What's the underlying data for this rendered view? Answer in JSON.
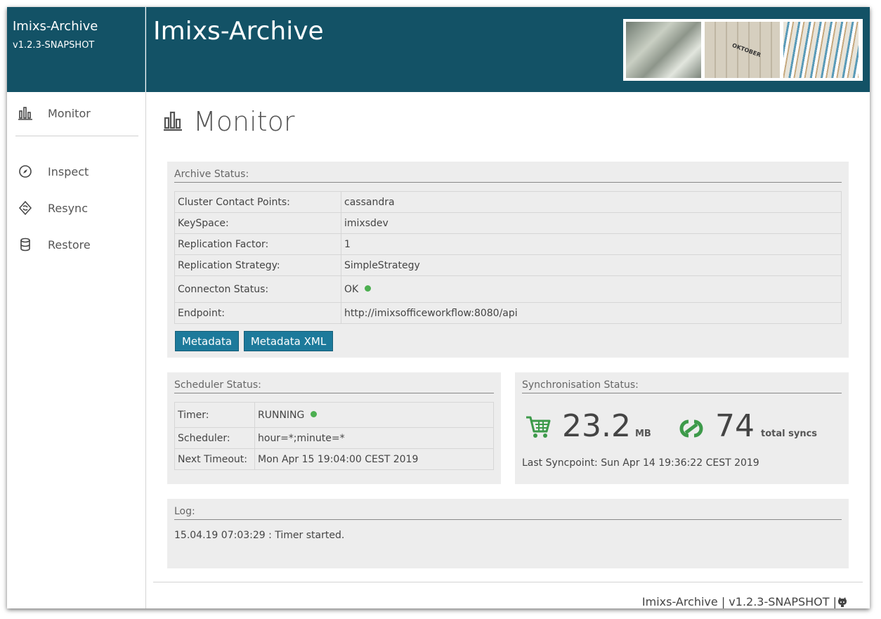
{
  "brand": {
    "name": "Imixs-Archive",
    "version": "v1.2.3-SNAPSHOT"
  },
  "header": {
    "title": "Imixs-Archive",
    "photo_caption": "OKTOBER"
  },
  "sidebar": {
    "items": [
      {
        "label": "Monitor",
        "icon": "bar-chart-icon"
      },
      {
        "label": "Inspect",
        "icon": "compass-icon"
      },
      {
        "label": "Resync",
        "icon": "sync-icon"
      },
      {
        "label": "Restore",
        "icon": "database-icon"
      }
    ]
  },
  "page": {
    "title": "Monitor"
  },
  "archive_status": {
    "title": "Archive Status:",
    "rows": [
      {
        "key": "Cluster Contact Points:",
        "value": "cassandra"
      },
      {
        "key": "KeySpace:",
        "value": "imixsdev"
      },
      {
        "key": "Replication Factor:",
        "value": "1"
      },
      {
        "key": "Replication Strategy:",
        "value": "SimpleStrategy"
      },
      {
        "key": "Connecton Status:",
        "value": "OK"
      },
      {
        "key": "Endpoint:",
        "value": "http://imixsofficeworkflow:8080/api"
      }
    ],
    "buttons": {
      "metadata": "Metadata",
      "metadata_xml": "Metadata XML"
    }
  },
  "scheduler_status": {
    "title": "Scheduler Status:",
    "rows": [
      {
        "key": "Timer:",
        "value": "RUNNING"
      },
      {
        "key": "Scheduler:",
        "value": "hour=*;minute=*"
      },
      {
        "key": "Next Timeout:",
        "value": "Mon Apr 15 19:04:00 CEST 2019"
      }
    ]
  },
  "sync_status": {
    "title": "Synchronisation Status:",
    "size_value": "23.2",
    "size_unit": "MB",
    "sync_count": "74",
    "sync_label": "total syncs",
    "last_syncpoint": "Last Syncpoint: Sun Apr 14 19:36:22 CEST 2019"
  },
  "log": {
    "title": "Log:",
    "entries": [
      "15.04.19 07:03:29 : Timer started."
    ]
  },
  "footer": {
    "text": "Imixs-Archive | v1.2.3-SNAPSHOT |"
  },
  "colors": {
    "header": "#135266",
    "button": "#1d7a9b",
    "status_ok": "#4caf50",
    "sync_icon": "#3d9a4a"
  }
}
